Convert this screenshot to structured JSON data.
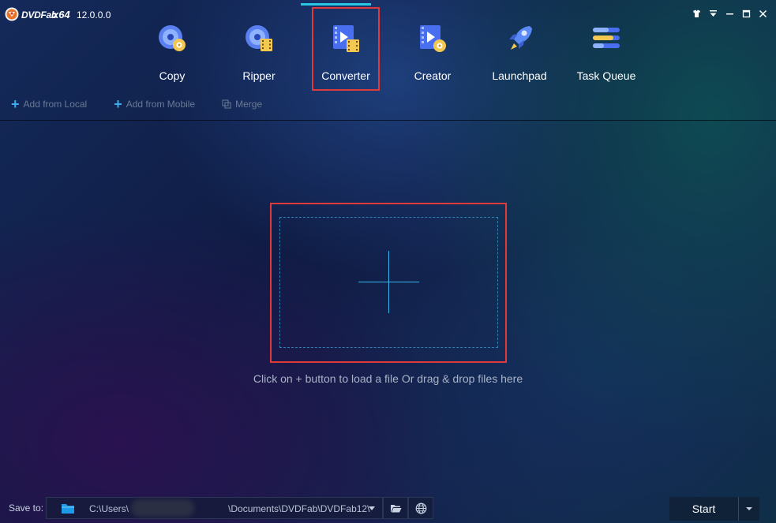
{
  "app": {
    "brand": "DVDFab",
    "arch": "x64",
    "version": "12.0.0.0"
  },
  "window_controls": [
    {
      "icon": "shirt-icon"
    },
    {
      "icon": "menu-icon"
    },
    {
      "icon": "minimize-icon"
    },
    {
      "icon": "maximize-icon"
    },
    {
      "icon": "close-icon"
    }
  ],
  "modules": [
    {
      "label": "Copy",
      "icon": "copy-disc-icon",
      "active": false
    },
    {
      "label": "Ripper",
      "icon": "ripper-disc-icon",
      "active": false
    },
    {
      "label": "Converter",
      "icon": "converter-film-icon",
      "active": true
    },
    {
      "label": "Creator",
      "icon": "creator-film-icon",
      "active": false
    },
    {
      "label": "Launchpad",
      "icon": "rocket-icon",
      "active": false
    },
    {
      "label": "Task Queue",
      "icon": "task-queue-icon",
      "active": false
    }
  ],
  "toolbar": {
    "add_local": "Add from Local",
    "add_mobile": "Add from Mobile",
    "merge": "Merge"
  },
  "drop_zone": {
    "hint": "Click on + button to load a file Or drag & drop files here"
  },
  "bottom": {
    "save_label": "Save to:",
    "path_prefix": "C:\\Users\\",
    "path_suffix": "\\Documents\\DVDFab\\DVDFab12\\",
    "start_label": "Start"
  },
  "colors": {
    "accent": "#27c6e4",
    "highlight_frame": "#e03a3a",
    "plus_blue": "#3ab4ec"
  }
}
